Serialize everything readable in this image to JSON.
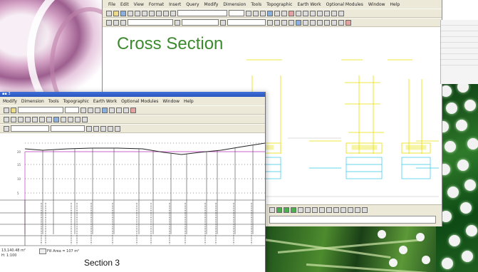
{
  "back_window": {
    "menu": [
      "File",
      "Edit",
      "View",
      "Format",
      "Insert",
      "Query",
      "Modify",
      "Dimension",
      "Tools",
      "Topographic",
      "Earth Work",
      "Optional Modules",
      "Window",
      "Help"
    ],
    "title": "Cross Section"
  },
  "front_window": {
    "titlebar": "▪▪ 3",
    "menu": [
      "Modify",
      "Dimension",
      "Tools",
      "Topographic",
      "Earth Work",
      "Optional Modules",
      "Window",
      "Help"
    ],
    "caption": "Section 3",
    "area_note": "13,140.48 m²",
    "fill_note": "Fill Area = 107 m²",
    "scale_note": "H: 1:100"
  },
  "colors": {
    "title_green": "#3c8a2e",
    "profile_line": "#222222",
    "design_line": "#cc66cc",
    "cad_yellow": "#e8e000",
    "cad_cyan": "#30c8e8"
  }
}
